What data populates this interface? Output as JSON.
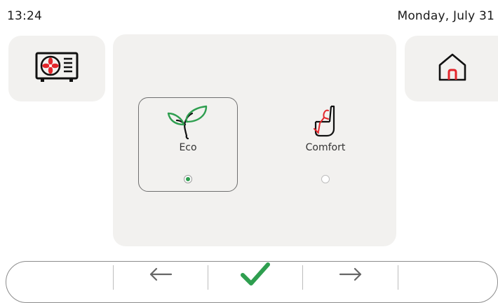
{
  "status_bar": {
    "time": "13:24",
    "date": "Monday, July 31"
  },
  "tiles": {
    "left_icon": "outdoor-unit-fan-icon",
    "right_icon": "home-icon"
  },
  "modes": [
    {
      "label": "Eco",
      "icon": "leaf-icon",
      "selected": true
    },
    {
      "label": "Comfort",
      "icon": "armchair-icon",
      "selected": false
    }
  ],
  "bottom_bar": {
    "back_icon": "arrow-left-icon",
    "confirm_icon": "checkmark-icon",
    "forward_icon": "arrow-right-icon"
  },
  "colors": {
    "accent_green": "#2e9e4f",
    "accent_red": "#e3262b",
    "panel": "#f2f1ef"
  }
}
